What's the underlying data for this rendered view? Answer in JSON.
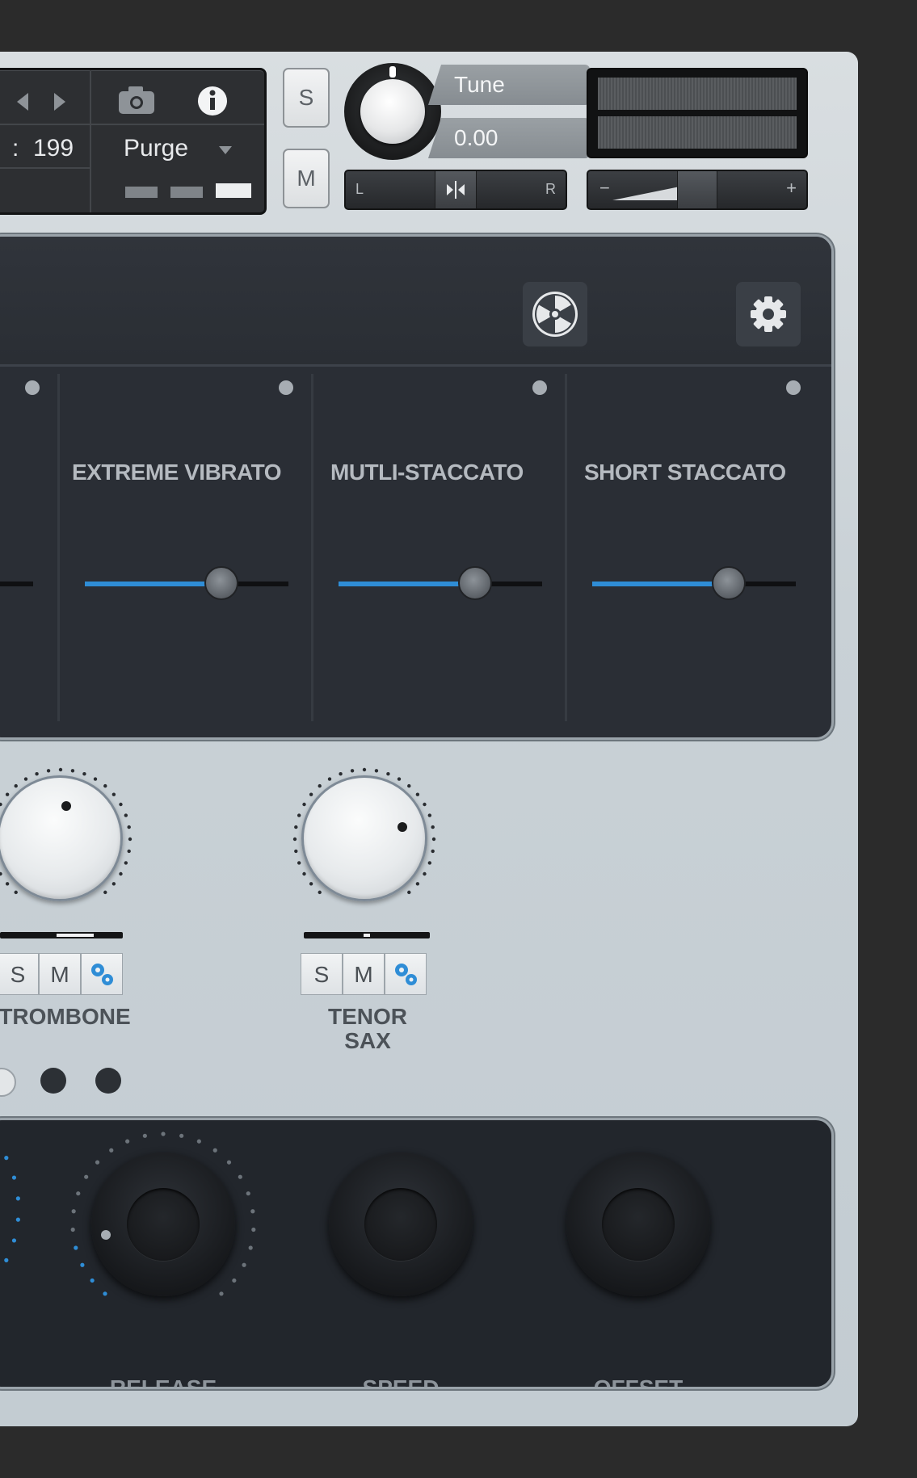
{
  "header": {
    "voice_count": "199",
    "voice_prefix": ":",
    "purge_label": "Purge",
    "solo_label": "S",
    "mute_label": "M",
    "tune_label": "Tune",
    "tune_value": "0.00",
    "pan_left": "L",
    "pan_right": "R",
    "vol_minus": "−",
    "vol_plus": "+"
  },
  "articulations": {
    "items": [
      {
        "label": "EXTREME VIBRATO",
        "value": 0.66
      },
      {
        "label": "MUTLI-STACCATO",
        "value": 0.66
      },
      {
        "label": "SHORT STACCATO",
        "value": 0.66
      }
    ]
  },
  "mixer": {
    "channels": [
      {
        "label": "TROMBONE",
        "solo": "S",
        "mute": "M"
      },
      {
        "label_line1": "TENOR",
        "label_line2": "SAX",
        "solo": "S",
        "mute": "M"
      }
    ]
  },
  "envelope": {
    "knobs": [
      {
        "label": "RELEASE"
      },
      {
        "label": "SPEED"
      },
      {
        "label": "OFFSET"
      }
    ]
  },
  "colors": {
    "accent": "#2f8dd6",
    "panel_dark": "#2a2e35",
    "plate": "#c9d1d6"
  }
}
